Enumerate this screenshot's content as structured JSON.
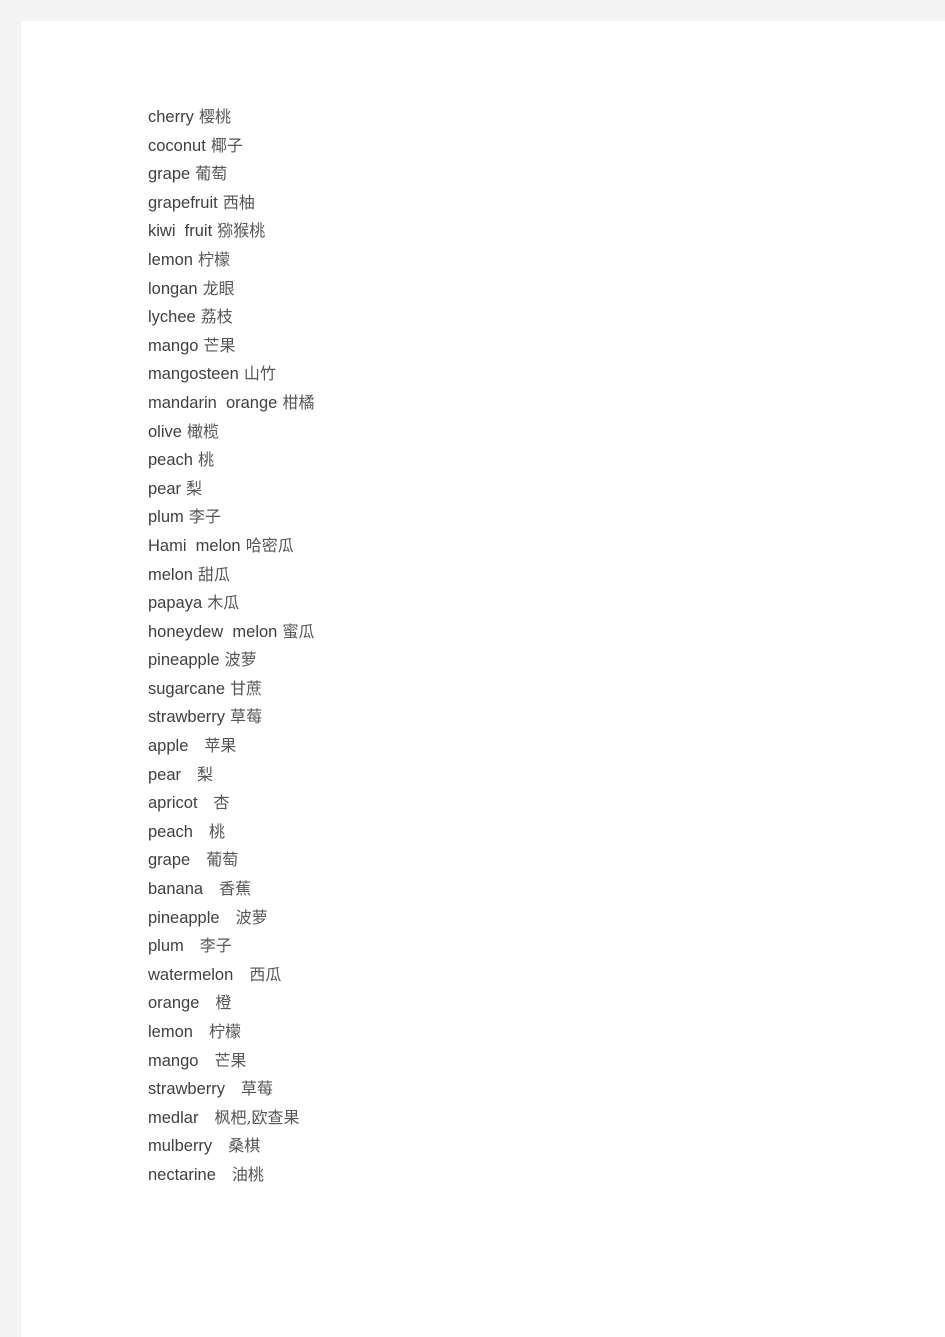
{
  "document": {
    "background_color": "#f4f4f4",
    "sheet_color": "#ffffff",
    "text_color_en": "#3f3f3f",
    "text_color_zh": "#56565a"
  },
  "vocab_list": {
    "name": "fruit-english-chinese-glossary",
    "entries": [
      {
        "en": "cherry",
        "zh": "樱桃",
        "spacing": "narrow"
      },
      {
        "en": "coconut",
        "zh": "椰子",
        "spacing": "narrow"
      },
      {
        "en": "grape",
        "zh": "葡萄",
        "spacing": "narrow"
      },
      {
        "en": "grapefruit",
        "zh": "西柚",
        "spacing": "narrow"
      },
      {
        "en": "kiwi  fruit",
        "zh": "猕猴桃",
        "spacing": "narrow"
      },
      {
        "en": "lemon",
        "zh": "柠檬",
        "spacing": "narrow"
      },
      {
        "en": "longan",
        "zh": "龙眼",
        "spacing": "narrow"
      },
      {
        "en": "lychee",
        "zh": "荔枝",
        "spacing": "narrow"
      },
      {
        "en": "mango",
        "zh": "芒果",
        "spacing": "narrow"
      },
      {
        "en": "mangosteen",
        "zh": "山竹",
        "spacing": "narrow"
      },
      {
        "en": "mandarin  orange",
        "zh": "柑橘",
        "spacing": "narrow"
      },
      {
        "en": "olive",
        "zh": "橄榄",
        "spacing": "narrow"
      },
      {
        "en": "peach",
        "zh": "桃",
        "spacing": "narrow"
      },
      {
        "en": "pear",
        "zh": "梨",
        "spacing": "narrow"
      },
      {
        "en": "plum",
        "zh": "李子",
        "spacing": "narrow"
      },
      {
        "en": "Hami  melon",
        "zh": "哈密瓜",
        "spacing": "narrow"
      },
      {
        "en": "melon",
        "zh": "甜瓜",
        "spacing": "narrow"
      },
      {
        "en": "papaya",
        "zh": "木瓜",
        "spacing": "narrow"
      },
      {
        "en": "honeydew  melon",
        "zh": "蜜瓜",
        "spacing": "narrow"
      },
      {
        "en": "pineapple",
        "zh": "波萝",
        "spacing": "narrow"
      },
      {
        "en": "sugarcane",
        "zh": "甘蔗",
        "spacing": "narrow"
      },
      {
        "en": "strawberry",
        "zh": "草莓",
        "spacing": "narrow"
      },
      {
        "en": "apple",
        "zh": "苹果",
        "spacing": "wide"
      },
      {
        "en": "pear",
        "zh": "梨",
        "spacing": "wide"
      },
      {
        "en": "apricot",
        "zh": "杏",
        "spacing": "wide"
      },
      {
        "en": "peach",
        "zh": "桃",
        "spacing": "wide"
      },
      {
        "en": "grape",
        "zh": "葡萄",
        "spacing": "wide"
      },
      {
        "en": "banana",
        "zh": "香蕉",
        "spacing": "wide"
      },
      {
        "en": "pineapple",
        "zh": "波萝",
        "spacing": "wide"
      },
      {
        "en": "plum",
        "zh": "李子",
        "spacing": "wide"
      },
      {
        "en": "watermelon",
        "zh": "西瓜",
        "spacing": "wide"
      },
      {
        "en": "orange",
        "zh": "橙",
        "spacing": "wide"
      },
      {
        "en": "lemon",
        "zh": "柠檬",
        "spacing": "wide"
      },
      {
        "en": "mango",
        "zh": "芒果",
        "spacing": "wide"
      },
      {
        "en": "strawberry",
        "zh": "草莓",
        "spacing": "wide"
      },
      {
        "en": "medlar",
        "zh": "枫杷,欧查果",
        "spacing": "wide"
      },
      {
        "en": "mulberry",
        "zh": "桑棋",
        "spacing": "wide"
      },
      {
        "en": "nectarine",
        "zh": "油桃",
        "spacing": "wide"
      }
    ]
  }
}
